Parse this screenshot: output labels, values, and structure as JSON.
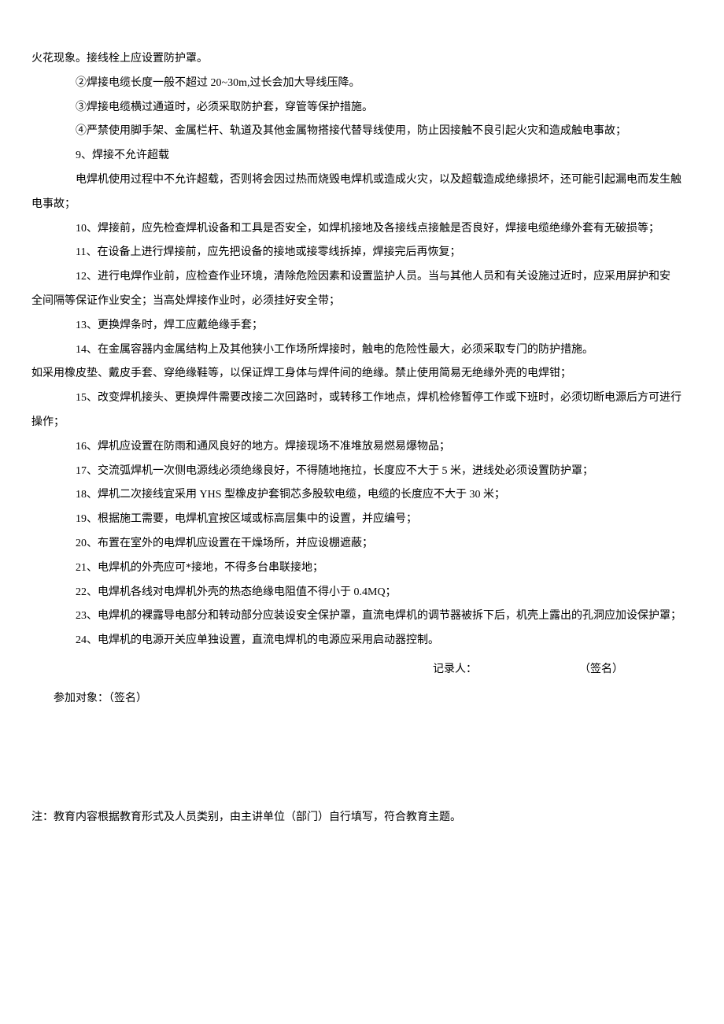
{
  "lines": {
    "l0": "火花现象。接线栓上应设置防护罩。",
    "l1": "②焊接电缆长度一般不超过 20~30m,过长会加大导线压降。",
    "l2": "③焊接电缆横过通道时，必须采取防护套，穿管等保护措施。",
    "l3": "④严禁使用脚手架、金属栏杆、轨道及其他金属物搭接代替导线使用，防止因接触不良引起火灾和造成触电事故；",
    "l4": "9、焊接不允许超载",
    "l5a": "电焊机使用过程中不允许超载，否则将会因过热而烧毁电焊机或造成火灾，以及超载造成绝缘损坏，还可能引起漏电而发生触",
    "l5b": "电事故；",
    "l6": "10、焊接前，应先检查焊机设备和工具是否安全，如焊机接地及各接线点接触是否良好，焊接电缆绝缘外套有无破损等；",
    "l7": "11、在设备上进行焊接前，应先把设备的接地或接零线拆掉，焊接完后再恢复；",
    "l8a": "12、进行电焊作业前，应检查作业环境，清除危险因素和设置监护人员。当与其他人员和有关设施过近时，应采用屏护和安",
    "l8b": "全间隔等保证作业安全；当高处焊接作业时，必须挂好安全带；",
    "l9": "13、更换焊条时，焊工应戴绝缘手套；",
    "l10a": "14、在金属容器内金属结构上及其他狭小工作场所焊接时，触电的危险性最大，必须采取专门的防护措施。",
    "l10b": "如采用橡皮垫、戴皮手套、穿绝缘鞋等，以保证焊工身体与焊件间的绝缘。禁止使用简易无绝缘外壳的电焊钳；",
    "l11a": "15、改变焊机接头、更换焊件需要改接二次回路时，或转移工作地点，焊机检修暂停工作或下班时，必须切断电源后方可进行",
    "l11b": "操作；",
    "l12": "16、焊机应设置在防雨和通风良好的地方。焊接现场不准堆放易燃易爆物品；",
    "l13": "17、交流弧焊机一次侧电源线必须绝缘良好，不得随地拖拉，长度应不大于 5 米，进线处必须设置防护罩；",
    "l14": "18、焊机二次接线宜采用 YHS 型橡皮护套铜芯多股软电缆，电缆的长度应不大于 30 米；",
    "l15": "19、根据施工需要，电焊机宜按区域或标高层集中的设置，并应编号；",
    "l16": "20、布置在室外的电焊机应设置在干燥场所，并应设棚遮蔽；",
    "l17": "21、电焊机的外壳应可*接地，不得多台串联接地；",
    "l18": "22、电焊机各线对电焊机外壳的热态绝缘电阻值不得小于 0.4MQ；",
    "l19": "23、电焊机的裸露导电部分和转动部分应装设安全保护罩，直流电焊机的调节器被拆下后，机壳上露出的孔洞应加设保护罩；",
    "l20": "24、电焊机的电源开关应单独设置，直流电焊机的电源应采用启动器控制。"
  },
  "sig": {
    "recorder_label": "记录人：",
    "recorder_sign": "（签名）",
    "participant": "参加对象：（签名）"
  },
  "note": "注：教育内容根据教育形式及人员类别，由主讲单位（部门）自行填写，符合教育主题。"
}
